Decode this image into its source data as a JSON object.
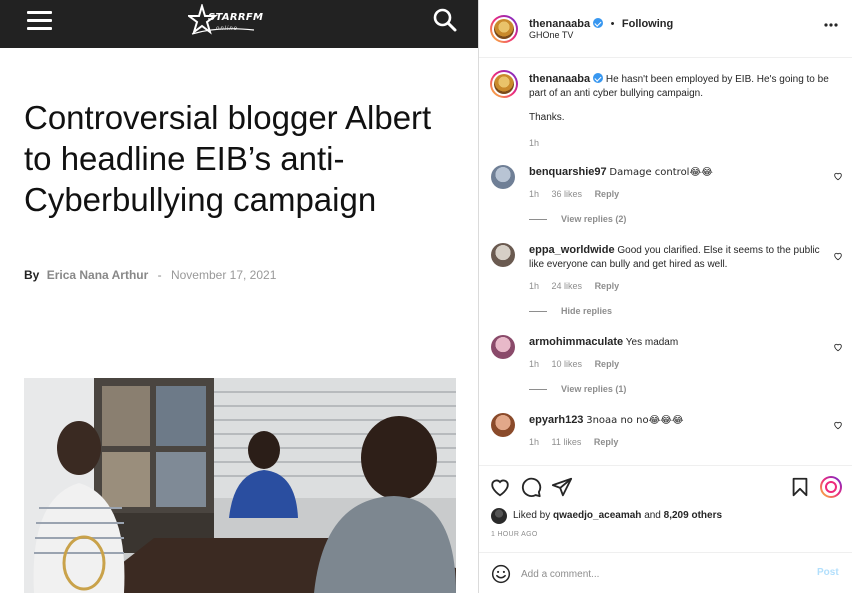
{
  "article": {
    "site_logo_text": "STARRFM",
    "site_logo_sub": "online",
    "headline": "Controversial blogger Albert to headline EIB’s anti-Cyberbullying campaign",
    "byline_by": "By",
    "author": "Erica Nana Arthur",
    "separator": "-",
    "date": "November 17, 2021"
  },
  "post": {
    "username": "thenanaaba",
    "follow_dot": "•",
    "follow_status": "Following",
    "location": "GHOne TV",
    "caption_username": "thenanaaba",
    "caption_text": "He hasn't been employed by EIB. He's going to be part of an anti cyber bullying campaign.",
    "caption_thanks": "Thanks.",
    "caption_time": "1h",
    "comments": [
      {
        "username": "benquarshie97",
        "text": "Damage control😂😂",
        "time": "1h",
        "likes": "36 likes",
        "reply": "Reply",
        "replies_toggle": "View replies (2)"
      },
      {
        "username": "eppa_worldwide",
        "text": "Good you clarified. Else it seems to the public like everyone can bully and get hired as well.",
        "time": "1h",
        "likes": "24 likes",
        "reply": "Reply",
        "replies_toggle": "Hide replies"
      },
      {
        "username": "armohimmaculate",
        "text": "Yes madam",
        "time": "1h",
        "likes": "10 likes",
        "reply": "Reply",
        "replies_toggle": "View replies (1)"
      },
      {
        "username": "epyarh123",
        "text": "3noaa no no😂😂😂",
        "time": "1h",
        "likes": "11 likes",
        "reply": "Reply"
      }
    ],
    "liked_by_prefix": "Liked by",
    "liked_by_user": "qwaedjo_aceamah",
    "liked_by_and": "and",
    "liked_by_count": "8,209 others",
    "post_time": "1 HOUR AGO",
    "comment_placeholder": "Add a comment...",
    "post_button": "Post"
  },
  "icons": {
    "menu": "hamburger-icon",
    "search": "search-icon",
    "more": "more-options-icon",
    "like": "heart-icon",
    "comment": "comment-icon",
    "share": "paper-plane-icon",
    "save": "bookmark-icon",
    "emoji": "emoji-icon"
  },
  "colors": {
    "topbar": "#222222",
    "verified": "#3897f0",
    "post_button_disabled": "#b2dffc",
    "muted_text": "#8e8e8e"
  }
}
